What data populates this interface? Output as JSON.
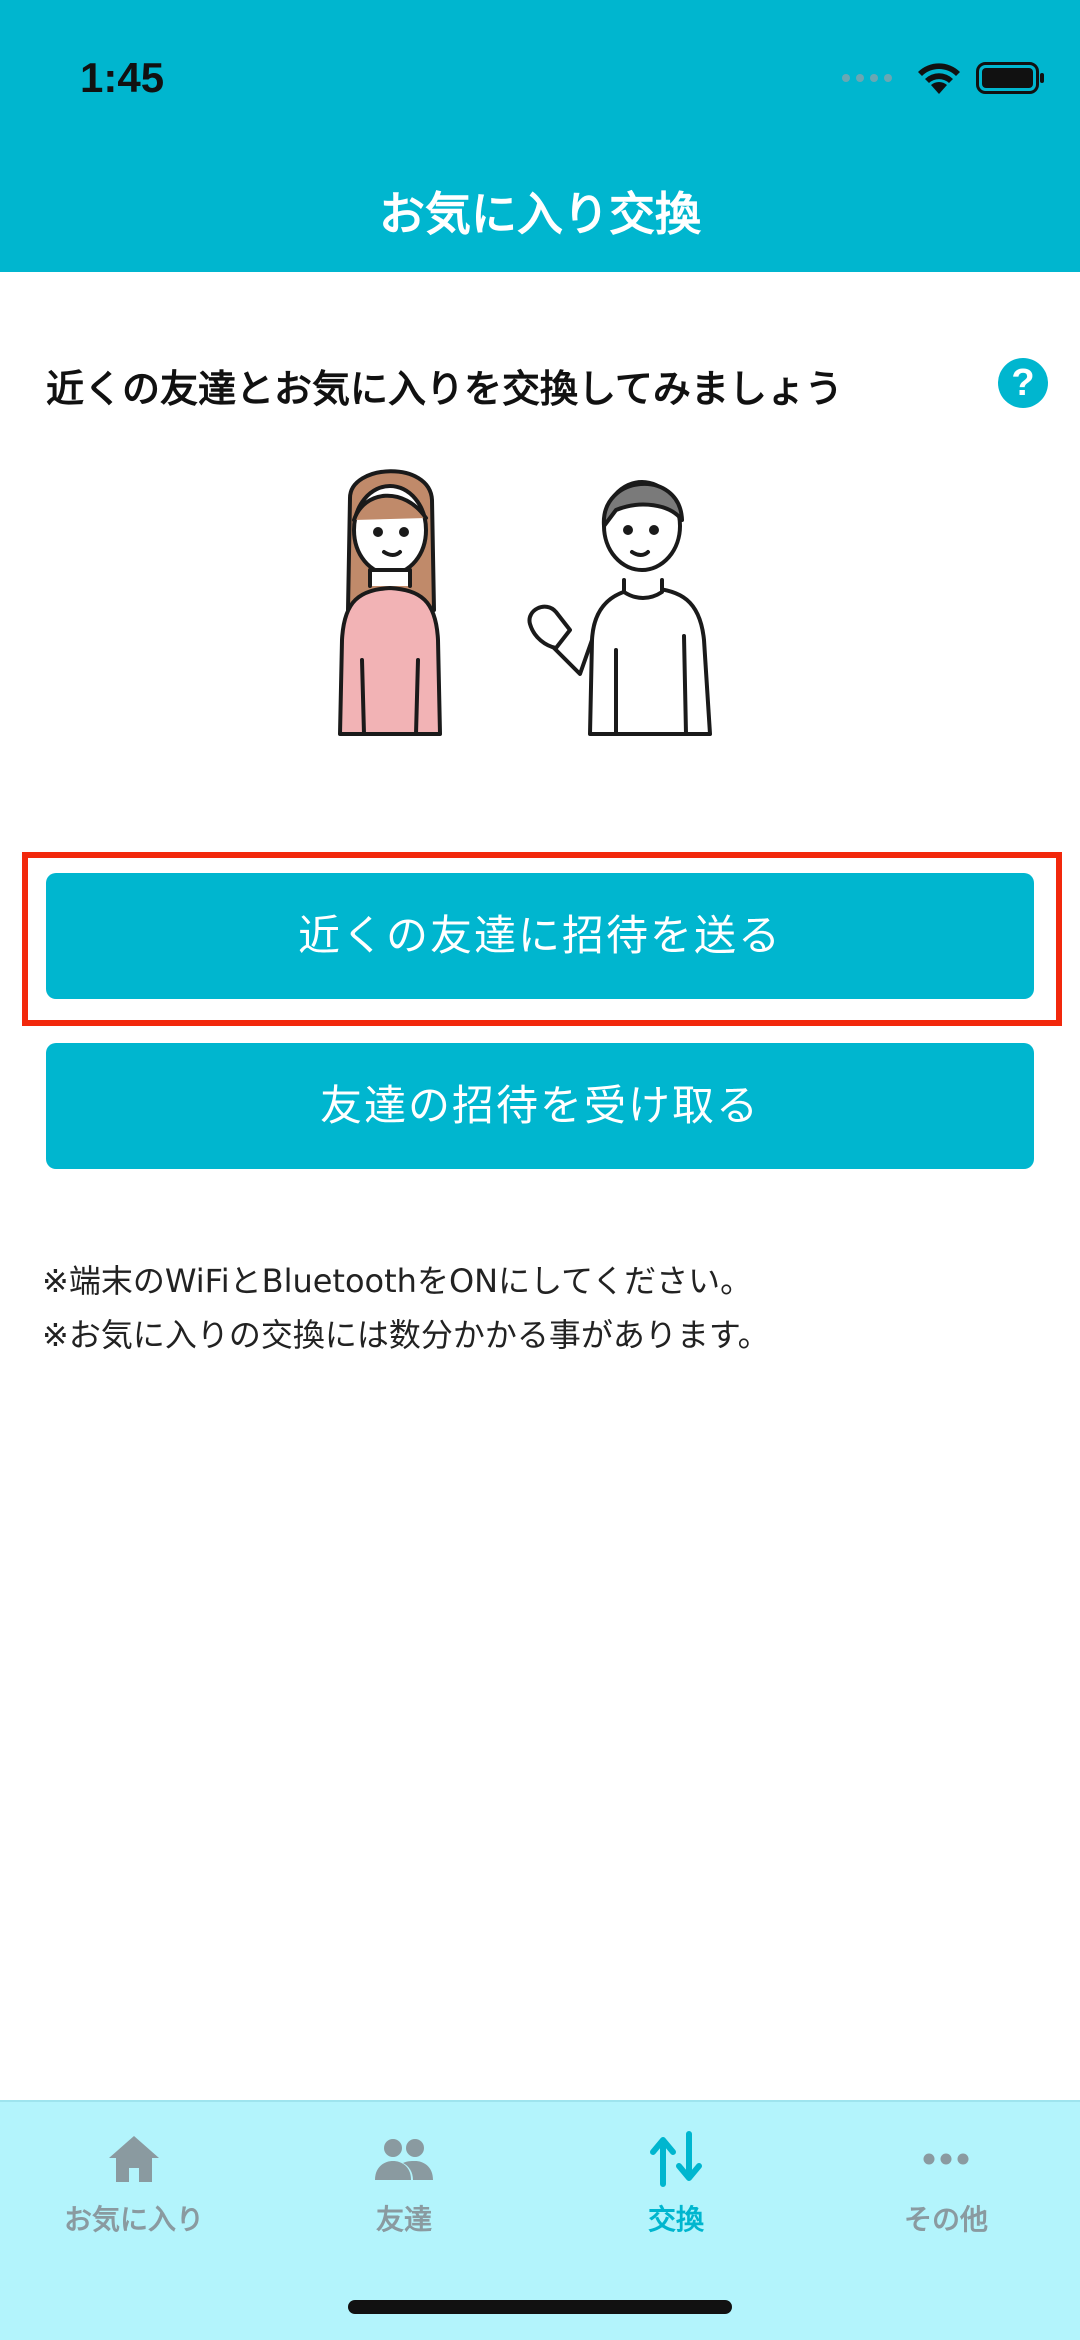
{
  "status": {
    "time": "1:45"
  },
  "header": {
    "title": "お気に入り交換"
  },
  "intro": {
    "text": "近くの友達とお気に入りを交換してみましょう",
    "help_icon": "question-circle-icon"
  },
  "buttons": {
    "send_invite": "近くの友達に招待を送る",
    "receive_invite": "友達の招待を受け取る"
  },
  "notes": [
    "※端末のWiFiとBluetoothをONにしてください。",
    "※お気に入りの交換には数分かかる事があります。"
  ],
  "tabs": [
    {
      "label": "お気に入り",
      "icon": "home-icon",
      "active": false
    },
    {
      "label": "友達",
      "icon": "people-icon",
      "active": false
    },
    {
      "label": "交換",
      "icon": "swap-icon",
      "active": true
    },
    {
      "label": "その他",
      "icon": "more-icon",
      "active": false
    }
  ],
  "colors": {
    "accent": "#00b6cf",
    "tabbar_bg": "#b3f4fc",
    "highlight": "#f2280c",
    "inactive_tab": "#8a9aa0"
  }
}
